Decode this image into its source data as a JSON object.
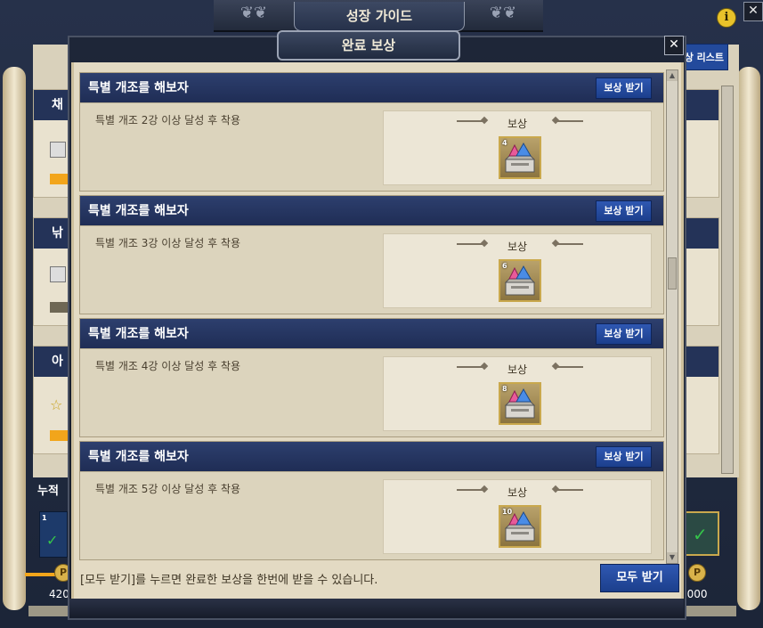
{
  "window": {
    "title": "성장 가이드",
    "info_icon": "i",
    "close_icon": "✕",
    "list_button_label": "상 리스트",
    "card_titles": [
      "채",
      "낚",
      "아"
    ],
    "cumulative_label": "누적",
    "left_points": "420",
    "right_points": "5000",
    "points_badge": "P"
  },
  "modal": {
    "title": "완료 보상",
    "close_icon": "✕",
    "reward_label": "보상",
    "missions": [
      {
        "title": "특별 개조를 해보자",
        "button": "보상 받기",
        "desc": "특별 개조 2강 이상 달성 후 착용",
        "reward_count": "4"
      },
      {
        "title": "특별 개조를 해보자",
        "button": "보상 받기",
        "desc": "특별 개조 3강 이상 달성 후 착용",
        "reward_count": "6"
      },
      {
        "title": "특별 개조를 해보자",
        "button": "보상 받기",
        "desc": "특별 개조 4강 이상 달성 후 착용",
        "reward_count": "8"
      },
      {
        "title": "특별 개조를 해보자",
        "button": "보상 받기",
        "desc": "특별 개조 5강 이상 달성 후 착용",
        "reward_count": "10"
      }
    ],
    "footer_text": "[모두 받기]를 누르면 완료한 보상을 한번에 받을 수 있습니다.",
    "claim_all_button": "모두 받기"
  },
  "colors": {
    "header_navy": "#1f2d55",
    "button_blue": "#2f58b2",
    "parchment": "#e3dac3"
  },
  "icons": {
    "reward_item": "gem-box-icon",
    "scroll_up": "arrow-up-icon",
    "scroll_down": "arrow-down-icon"
  }
}
